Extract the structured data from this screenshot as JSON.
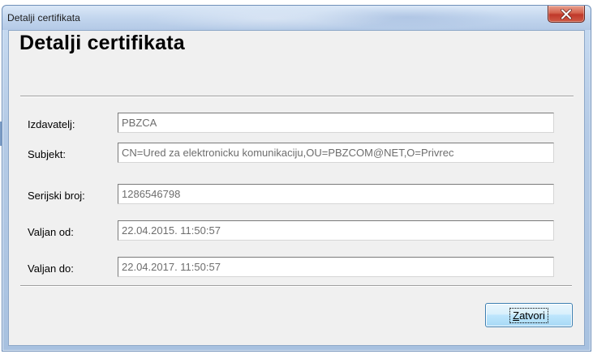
{
  "window": {
    "title": "Detalji certifikata"
  },
  "dialog": {
    "heading": "Detalji certifikata",
    "fields": [
      {
        "label": "Izdavatelj:",
        "value": "PBZCA"
      },
      {
        "label": "Subjekt:",
        "value": "CN=Ured za elektronicku komunikaciju,OU=PBZCOM@NET,O=Privrec"
      },
      {
        "label": "Serijski broj:",
        "value": "1286546798"
      },
      {
        "label": "Valjan od:",
        "value": "22.04.2015. 11:50:57"
      },
      {
        "label": "Valjan do:",
        "value": "22.04.2017. 11:50:57"
      }
    ],
    "close_button": {
      "mnemonic": "Z",
      "rest": "atvori"
    }
  },
  "colors": {
    "close_button_red": "#c0392b",
    "frame_blue": "#b5cbe6",
    "client_gray": "#f0f0f0",
    "button_border": "#3c7fb1"
  },
  "icons": {
    "window_close": "close-icon"
  }
}
